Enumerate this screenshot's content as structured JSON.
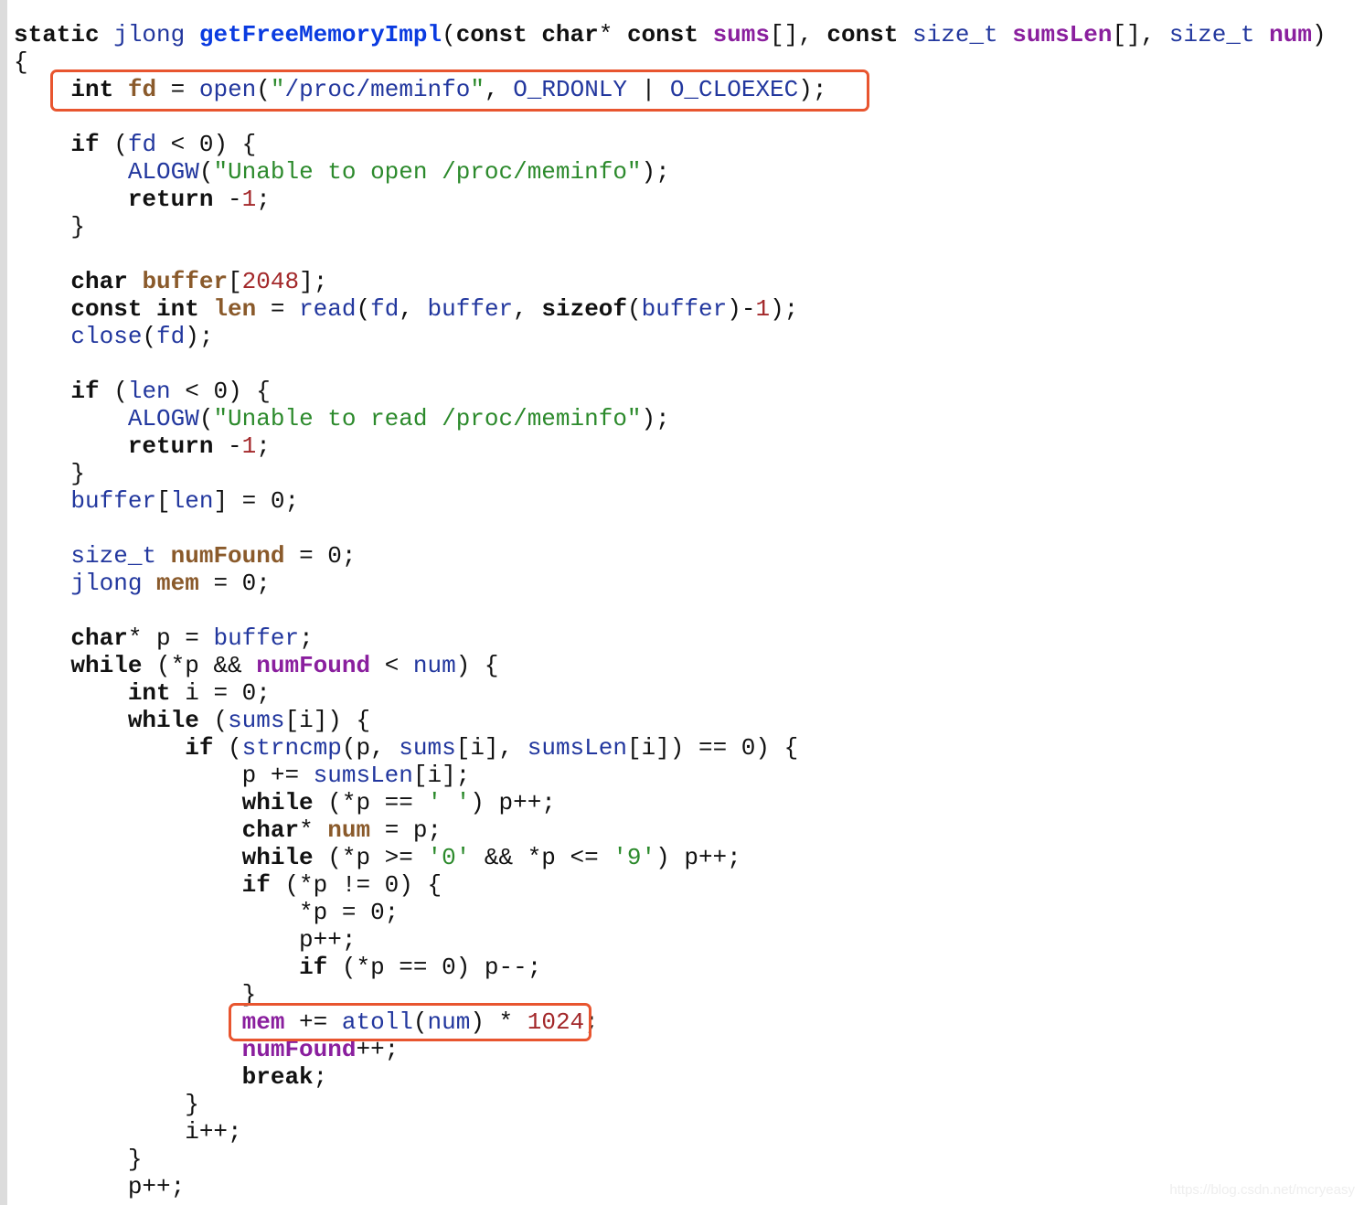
{
  "colors": {
    "highlight_box": "#e8552f",
    "keyword": "#111111",
    "type": "#22379e",
    "function_name": "#0a3be0",
    "declared_var": "#8a5a2b",
    "param": "#8a1f9e",
    "string": "#2c8a2c",
    "number": "#a3282a"
  },
  "watermark": "https://blog.csdn.net/mcryeasy",
  "lines": [
    [
      [
        "k",
        "static "
      ],
      [
        "t",
        "jlong "
      ],
      [
        "f",
        "getFreeMemoryImpl"
      ],
      [
        "o",
        "("
      ],
      [
        "k",
        "const char"
      ],
      [
        "o",
        "* "
      ],
      [
        "k",
        "const "
      ],
      [
        "p",
        "sums"
      ],
      [
        "o",
        "[], "
      ],
      [
        "k",
        "const "
      ],
      [
        "t",
        "size_t "
      ],
      [
        "p",
        "sumsLen"
      ],
      [
        "o",
        "[], "
      ],
      [
        "t",
        "size_t "
      ],
      [
        "p",
        "num"
      ],
      [
        "o",
        ")"
      ]
    ],
    [
      [
        "o",
        "{"
      ]
    ],
    [
      [
        "o",
        "    "
      ],
      [
        "k",
        "int "
      ],
      [
        "v",
        "fd"
      ],
      [
        "o",
        " = "
      ],
      [
        "t",
        "open"
      ],
      [
        "o",
        "("
      ],
      [
        "s",
        "\""
      ],
      [
        "t",
        "/proc/meminfo"
      ],
      [
        "s",
        "\""
      ],
      [
        "o",
        ", "
      ],
      [
        "t",
        "O_RDONLY"
      ],
      [
        "o",
        " | "
      ],
      [
        "t",
        "O_CLOEXEC"
      ],
      [
        "o",
        ");"
      ]
    ],
    [
      [
        "o",
        ""
      ]
    ],
    [
      [
        "o",
        "    "
      ],
      [
        "k",
        "if "
      ],
      [
        "o",
        "("
      ],
      [
        "t",
        "fd"
      ],
      [
        "o",
        " < 0) {"
      ]
    ],
    [
      [
        "o",
        "        "
      ],
      [
        "t",
        "ALOGW"
      ],
      [
        "o",
        "("
      ],
      [
        "s",
        "\"Unable to open /proc/meminfo\""
      ],
      [
        "o",
        ");"
      ]
    ],
    [
      [
        "o",
        "        "
      ],
      [
        "k",
        "return "
      ],
      [
        "o",
        "-"
      ],
      [
        "n",
        "1"
      ],
      [
        "o",
        ";"
      ]
    ],
    [
      [
        "o",
        "    }"
      ]
    ],
    [
      [
        "o",
        ""
      ]
    ],
    [
      [
        "o",
        "    "
      ],
      [
        "k",
        "char "
      ],
      [
        "v",
        "buffer"
      ],
      [
        "o",
        "["
      ],
      [
        "n",
        "2048"
      ],
      [
        "o",
        "];"
      ]
    ],
    [
      [
        "o",
        "    "
      ],
      [
        "k",
        "const int "
      ],
      [
        "v",
        "len"
      ],
      [
        "o",
        " = "
      ],
      [
        "t",
        "read"
      ],
      [
        "o",
        "("
      ],
      [
        "t",
        "fd"
      ],
      [
        "o",
        ", "
      ],
      [
        "t",
        "buffer"
      ],
      [
        "o",
        ", "
      ],
      [
        "k",
        "sizeof"
      ],
      [
        "o",
        "("
      ],
      [
        "t",
        "buffer"
      ],
      [
        "o",
        ")-"
      ],
      [
        "n",
        "1"
      ],
      [
        "o",
        ");"
      ]
    ],
    [
      [
        "o",
        "    "
      ],
      [
        "t",
        "close"
      ],
      [
        "o",
        "("
      ],
      [
        "t",
        "fd"
      ],
      [
        "o",
        ");"
      ]
    ],
    [
      [
        "o",
        ""
      ]
    ],
    [
      [
        "o",
        "    "
      ],
      [
        "k",
        "if "
      ],
      [
        "o",
        "("
      ],
      [
        "t",
        "len"
      ],
      [
        "o",
        " < 0) {"
      ]
    ],
    [
      [
        "o",
        "        "
      ],
      [
        "t",
        "ALOGW"
      ],
      [
        "o",
        "("
      ],
      [
        "s",
        "\"Unable to read /proc/meminfo\""
      ],
      [
        "o",
        ");"
      ]
    ],
    [
      [
        "o",
        "        "
      ],
      [
        "k",
        "return "
      ],
      [
        "o",
        "-"
      ],
      [
        "n",
        "1"
      ],
      [
        "o",
        ";"
      ]
    ],
    [
      [
        "o",
        "    }"
      ]
    ],
    [
      [
        "o",
        "    "
      ],
      [
        "t",
        "buffer"
      ],
      [
        "o",
        "["
      ],
      [
        "t",
        "len"
      ],
      [
        "o",
        "] = 0;"
      ]
    ],
    [
      [
        "o",
        ""
      ]
    ],
    [
      [
        "o",
        "    "
      ],
      [
        "t",
        "size_t "
      ],
      [
        "v",
        "numFound"
      ],
      [
        "o",
        " = 0;"
      ]
    ],
    [
      [
        "o",
        "    "
      ],
      [
        "t",
        "jlong "
      ],
      [
        "v",
        "mem"
      ],
      [
        "o",
        " = 0;"
      ]
    ],
    [
      [
        "o",
        ""
      ]
    ],
    [
      [
        "o",
        "    "
      ],
      [
        "k",
        "char"
      ],
      [
        "o",
        "* p = "
      ],
      [
        "t",
        "buffer"
      ],
      [
        "o",
        ";"
      ]
    ],
    [
      [
        "o",
        "    "
      ],
      [
        "k",
        "while "
      ],
      [
        "o",
        "(*p && "
      ],
      [
        "p",
        "numFound"
      ],
      [
        "o",
        " < "
      ],
      [
        "t",
        "num"
      ],
      [
        "o",
        ") {"
      ]
    ],
    [
      [
        "o",
        "        "
      ],
      [
        "k",
        "int "
      ],
      [
        "o",
        "i = 0;"
      ]
    ],
    [
      [
        "o",
        "        "
      ],
      [
        "k",
        "while "
      ],
      [
        "o",
        "("
      ],
      [
        "t",
        "sums"
      ],
      [
        "o",
        "[i]) {"
      ]
    ],
    [
      [
        "o",
        "            "
      ],
      [
        "k",
        "if "
      ],
      [
        "o",
        "("
      ],
      [
        "t",
        "strncmp"
      ],
      [
        "o",
        "(p, "
      ],
      [
        "t",
        "sums"
      ],
      [
        "o",
        "[i], "
      ],
      [
        "t",
        "sumsLen"
      ],
      [
        "o",
        "[i]) == 0) {"
      ]
    ],
    [
      [
        "o",
        "                p += "
      ],
      [
        "t",
        "sumsLen"
      ],
      [
        "o",
        "[i];"
      ]
    ],
    [
      [
        "o",
        "                "
      ],
      [
        "k",
        "while "
      ],
      [
        "o",
        "(*p == "
      ],
      [
        "s",
        "' '"
      ],
      [
        "o",
        ") p++;"
      ]
    ],
    [
      [
        "o",
        "                "
      ],
      [
        "k",
        "char"
      ],
      [
        "o",
        "* "
      ],
      [
        "v",
        "num"
      ],
      [
        "o",
        " = p;"
      ]
    ],
    [
      [
        "o",
        "                "
      ],
      [
        "k",
        "while "
      ],
      [
        "o",
        "(*p >= "
      ],
      [
        "s",
        "'0'"
      ],
      [
        "o",
        " && *p <= "
      ],
      [
        "s",
        "'9'"
      ],
      [
        "o",
        ") p++;"
      ]
    ],
    [
      [
        "o",
        "                "
      ],
      [
        "k",
        "if "
      ],
      [
        "o",
        "(*p != 0) {"
      ]
    ],
    [
      [
        "o",
        "                    *p = 0;"
      ]
    ],
    [
      [
        "o",
        "                    p++;"
      ]
    ],
    [
      [
        "o",
        "                    "
      ],
      [
        "k",
        "if "
      ],
      [
        "o",
        "(*p == 0) p--;"
      ]
    ],
    [
      [
        "o",
        "                }"
      ]
    ],
    [
      [
        "o",
        "                "
      ],
      [
        "p",
        "mem"
      ],
      [
        "o",
        " += "
      ],
      [
        "t",
        "atoll"
      ],
      [
        "o",
        "("
      ],
      [
        "t",
        "num"
      ],
      [
        "o",
        ") * "
      ],
      [
        "n",
        "1024"
      ],
      [
        "o",
        ";"
      ]
    ],
    [
      [
        "o",
        "                "
      ],
      [
        "p",
        "numFound"
      ],
      [
        "o",
        "++;"
      ]
    ],
    [
      [
        "o",
        "                "
      ],
      [
        "k",
        "break"
      ],
      [
        "o",
        ";"
      ]
    ],
    [
      [
        "o",
        "            }"
      ]
    ],
    [
      [
        "o",
        "            i++;"
      ]
    ],
    [
      [
        "o",
        "        }"
      ]
    ],
    [
      [
        "o",
        "        p++;"
      ]
    ]
  ]
}
